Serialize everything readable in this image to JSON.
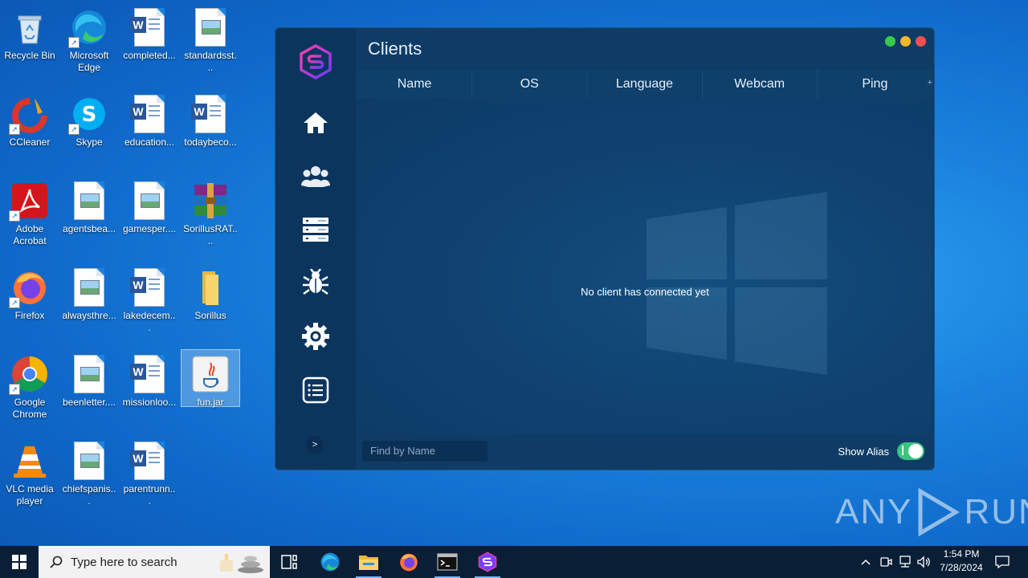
{
  "desktop": {
    "icons": [
      {
        "label": "Recycle Bin",
        "type": "recycle"
      },
      {
        "label": "Microsoft Edge",
        "type": "edge"
      },
      {
        "label": "completed...",
        "type": "word"
      },
      {
        "label": "standardsst...",
        "type": "image"
      },
      {
        "label": "CCleaner",
        "type": "ccleaner"
      },
      {
        "label": "Skype",
        "type": "skype"
      },
      {
        "label": "education...",
        "type": "word"
      },
      {
        "label": "todaybeco...",
        "type": "word"
      },
      {
        "label": "Adobe Acrobat",
        "type": "acrobat"
      },
      {
        "label": "agentsbea...",
        "type": "image"
      },
      {
        "label": "gamesper....",
        "type": "image"
      },
      {
        "label": "SorillusRAT....",
        "type": "winrar"
      },
      {
        "label": "Firefox",
        "type": "firefox"
      },
      {
        "label": "alwaysthre...",
        "type": "image"
      },
      {
        "label": "lakedecem...",
        "type": "word"
      },
      {
        "label": "Sorillus",
        "type": "folder"
      },
      {
        "label": "Google Chrome",
        "type": "chrome"
      },
      {
        "label": "beenletter....",
        "type": "image"
      },
      {
        "label": "missionloo...",
        "type": "word"
      },
      {
        "label": "fun.jar",
        "type": "java"
      },
      {
        "label": "VLC media player",
        "type": "vlc"
      },
      {
        "label": "chiefspanis...",
        "type": "image"
      },
      {
        "label": "parentrunn...",
        "type": "word"
      }
    ]
  },
  "app": {
    "title": "Clients",
    "columns": [
      "Name",
      "OS",
      "Language",
      "Webcam",
      "Ping"
    ],
    "header_plus": "+",
    "empty_message": "No client has connected yet",
    "search_placeholder": "Find by Name",
    "show_alias_label": "Show Alias",
    "show_alias_on": true,
    "expand_label": ">",
    "nav": [
      "home-icon",
      "users-icon",
      "servers-icon",
      "bug-icon",
      "settings-icon",
      "list-icon"
    ],
    "colors": {
      "close": "#ee4f4f",
      "minimize": "#f2b72a",
      "maximize": "#3ac94b",
      "toggle": "#3ac47d"
    }
  },
  "watermark": {
    "left": "ANY",
    "right": "RUN"
  },
  "taskbar": {
    "search_placeholder": "Type here to search",
    "time": "1:54 PM",
    "date": "7/28/2024"
  }
}
